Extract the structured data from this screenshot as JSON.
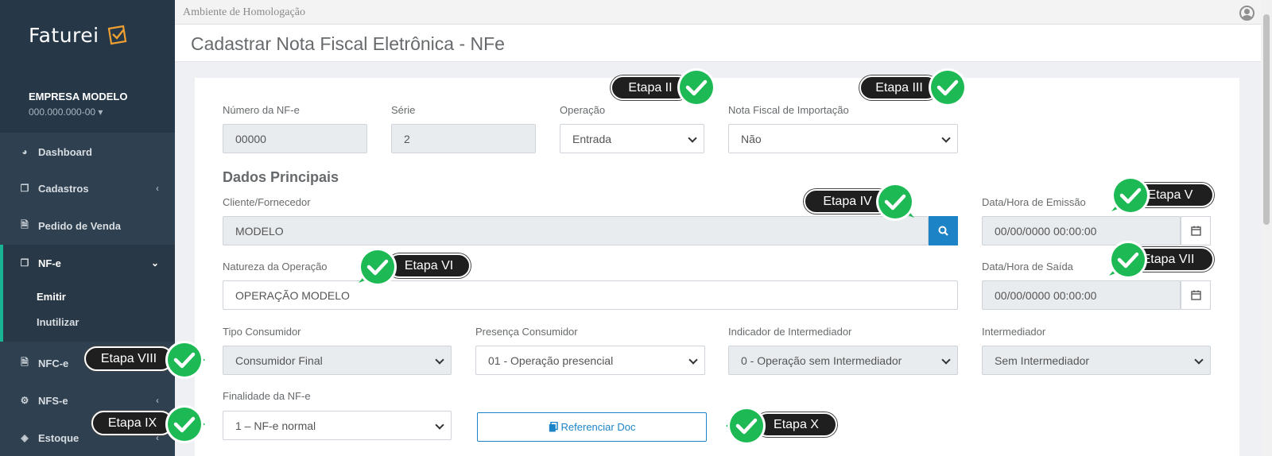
{
  "app": {
    "brand": "Faturei",
    "environment": "Ambiente de Homologação",
    "page_title": "Cadastrar Nota Fiscal Eletrônica - NFe"
  },
  "company": {
    "name": "EMPRESA MODELO",
    "cnpj": "000.000.000-00"
  },
  "sidebar": {
    "items": [
      {
        "label": "Dashboard",
        "icon": "dashboard-icon"
      },
      {
        "label": "Cadastros",
        "icon": "copy-icon"
      },
      {
        "label": "Pedido de Venda",
        "icon": "file-icon"
      },
      {
        "label": "NF-e",
        "icon": "copy-icon"
      },
      {
        "label": "NFC-e",
        "icon": "file-icon"
      },
      {
        "label": "NFS-e",
        "icon": "gears-icon"
      },
      {
        "label": "Estoque",
        "icon": "cube-icon"
      }
    ],
    "nfe_sub": [
      {
        "label": "Emitir"
      },
      {
        "label": "Inutilizar"
      }
    ]
  },
  "form": {
    "numero": {
      "label": "Número da NF-e",
      "value": "00000"
    },
    "serie": {
      "label": "Série",
      "value": "2"
    },
    "operacao": {
      "label": "Operação",
      "value": "Entrada"
    },
    "importacao": {
      "label": "Nota Fiscal de Importação",
      "value": "Não"
    },
    "section_title": "Dados Principais",
    "cliente": {
      "label": "Cliente/Fornecedor",
      "value": "MODELO"
    },
    "emissao": {
      "label": "Data/Hora de Emissão",
      "value": "00/00/0000 00:00:00"
    },
    "natureza": {
      "label": "Natureza da Operação",
      "value": "OPERAÇÃO MODELO"
    },
    "saida": {
      "label": "Data/Hora de Saída",
      "value": "00/00/0000 00:00:00"
    },
    "tipo_consumidor": {
      "label": "Tipo Consumidor",
      "value": "Consumidor Final"
    },
    "presenca": {
      "label": "Presença Consumidor",
      "value": "01 - Operação presencial"
    },
    "indicador": {
      "label": "Indicador de Intermediador",
      "value": "0 - Operação sem Intermediador"
    },
    "intermediador": {
      "label": "Intermediador",
      "value": "Sem Intermediador"
    },
    "finalidade": {
      "label": "Finalidade da NF-e",
      "value": "1 – NF-e normal"
    },
    "referenciar_label": "Referenciar Doc"
  },
  "etapas": [
    "Etapa II",
    "Etapa III",
    "Etapa IV",
    "Etapa V",
    "Etapa VI",
    "Etapa VII",
    "Etapa VIII",
    "Etapa IX",
    "Etapa X"
  ],
  "colors": {
    "sidebar": "#2f4050",
    "accent": "#1ab394",
    "primary": "#1c84c6",
    "check_green": "#1db954"
  }
}
